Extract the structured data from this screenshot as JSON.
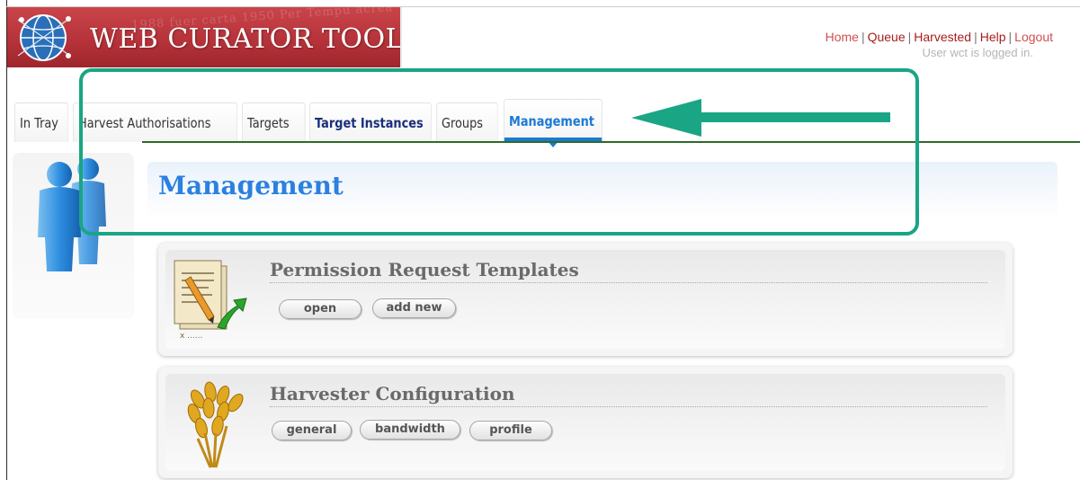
{
  "app": {
    "title": "WEB CURATOR TOOL",
    "logo_background_text": "1988  fuer  carta  1950  Per  Tempu  acrea"
  },
  "top_links": {
    "items": [
      "Home",
      "Queue",
      "Harvested",
      "Help",
      "Logout"
    ],
    "separator": "|",
    "login_status": "User wct is logged in."
  },
  "tabs": {
    "items": [
      "In Tray",
      "Harvest Authorisations",
      "Targets",
      "Target Instances",
      "Groups",
      "Management"
    ],
    "active": "Management"
  },
  "page": {
    "title": "Management"
  },
  "sections": [
    {
      "title": "Permission Request Templates",
      "icon": "document-pencil-icon",
      "buttons": [
        "open",
        "add new"
      ]
    },
    {
      "title": "Harvester Configuration",
      "icon": "wheat-icon",
      "buttons": [
        "general",
        "bandwidth",
        "profile"
      ]
    }
  ],
  "colors": {
    "brand_red": "#b6333a",
    "active_tab": "#1c79d4",
    "title_blue": "#2b80e0",
    "annotation": "#1aa584",
    "divider_green": "#2e6a2a"
  }
}
